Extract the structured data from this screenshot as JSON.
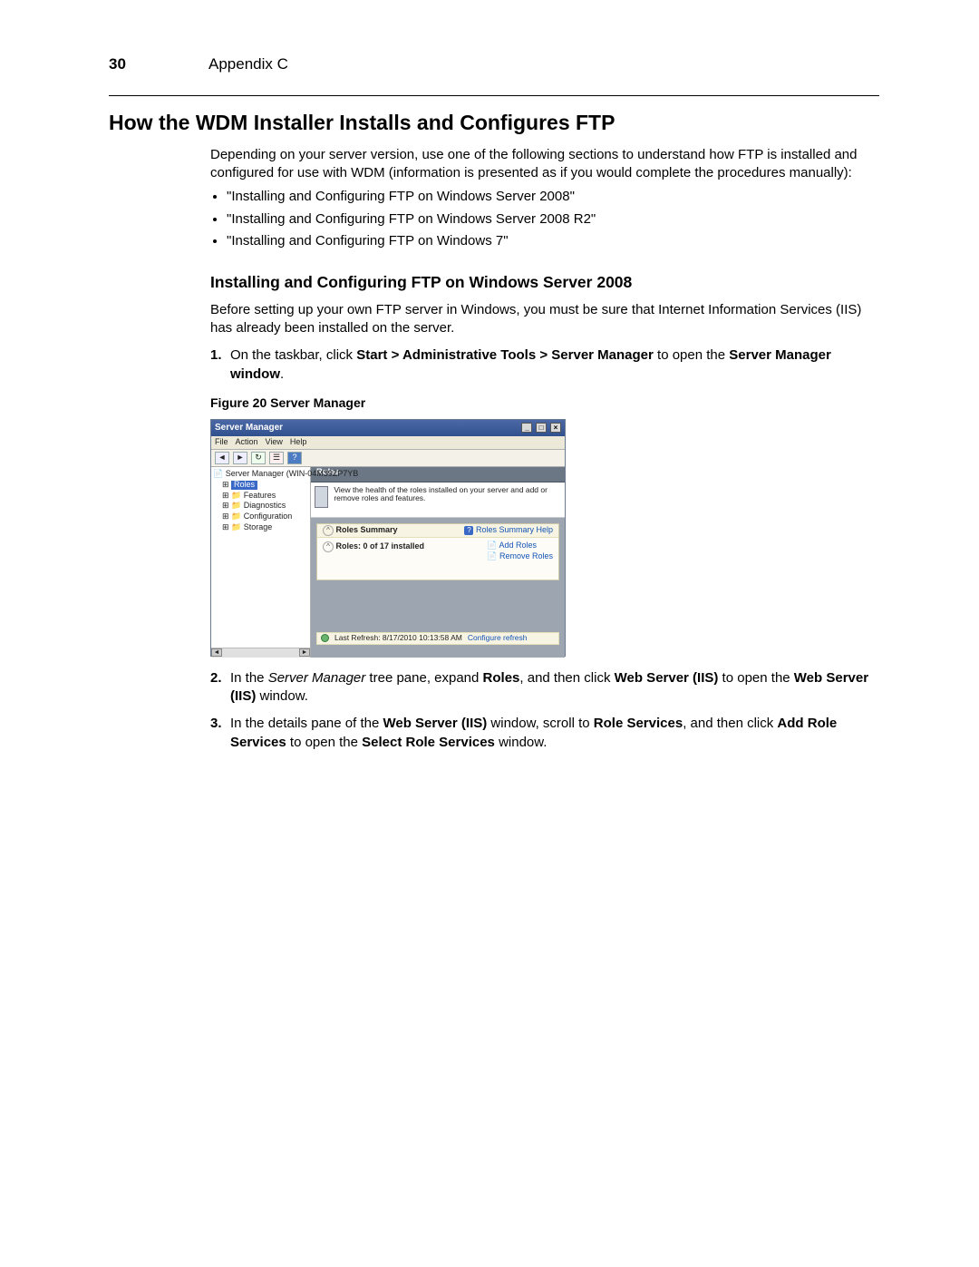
{
  "header": {
    "page_number": "30",
    "chapter": "Appendix C"
  },
  "h1": "How the WDM Installer Installs and Configures FTP",
  "intro": "Depending on your server version, use one of the following sections to understand how FTP is installed and configured for use with WDM (information is presented as if you would complete the procedures manually):",
  "bullets": [
    "\"Installing and Configuring FTP on Windows Server 2008\"",
    "\"Installing and Configuring FTP on Windows Server 2008 R2\"",
    "\"Installing and Configuring FTP on Windows 7\""
  ],
  "h2": "Installing and Configuring FTP on Windows Server 2008",
  "para2": "Before setting up your own FTP server in Windows, you must be sure that Internet Information Services (IIS) has already been installed on the server.",
  "step1": {
    "num": "1.",
    "pre": "On the taskbar, click ",
    "bold1": "Start > Administrative Tools > Server Manager",
    "mid": " to open the ",
    "bold2": "Server Manager window",
    "end": "."
  },
  "fig_caption": "Figure 20    Server Manager",
  "sm": {
    "title": "Server Manager",
    "menu": [
      "File",
      "Action",
      "View",
      "Help"
    ],
    "toolbar_icons": [
      "back-arrow-icon",
      "forward-arrow-icon",
      "refresh-icon",
      "properties-icon",
      "help-icon"
    ],
    "tree_root": "Server Manager (WIN-04M39ZP7YB",
    "tree_items": [
      "Roles",
      "Features",
      "Diagnostics",
      "Configuration",
      "Storage"
    ],
    "content_header": "Roles",
    "banner_text": "View the health of the roles installed on your server and add or remove roles and features.",
    "summary_title": "Roles Summary",
    "summary_help": "Roles Summary Help",
    "roles_count": "Roles: 0 of 17 installed",
    "add_roles": "Add Roles",
    "remove_roles": "Remove Roles",
    "status_text": "Last Refresh: 8/17/2010 10:13:58 AM",
    "status_link": "Configure refresh"
  },
  "step2": {
    "num": "2.",
    "t1": "In the ",
    "italic": "Server Manager",
    "t2": " tree pane, expand ",
    "b1": "Roles",
    "t3": ", and then click ",
    "b2": "Web Server (IIS)",
    "t4": " to open the ",
    "b3": "Web Server (IIS)",
    "t5": " window."
  },
  "step3": {
    "num": "3.",
    "t1": "In the details pane of the ",
    "b1": "Web Server (IIS)",
    "t2": " window, scroll to ",
    "b2": "Role Services",
    "t3": ", and then click ",
    "b3": "Add Role Services",
    "t4": " to open the ",
    "b4": "Select Role Services",
    "t5": " window."
  }
}
